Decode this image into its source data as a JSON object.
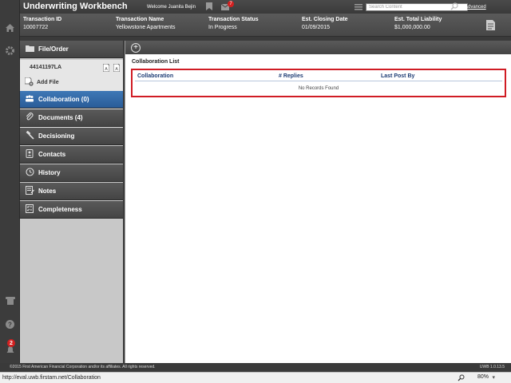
{
  "header": {
    "app_title": "Underwriting Workbench",
    "welcome": "Welcome Juanita Bejin",
    "messages_badge": "7",
    "search_placeholder": "Search Content",
    "advanced_link": "Advanced"
  },
  "transaction": {
    "columns": [
      {
        "label": "Transaction ID",
        "value": "10007722"
      },
      {
        "label": "Transaction Name",
        "value": "Yellowstone Apartments"
      },
      {
        "label": "Transaction Status",
        "value": "In Progress"
      },
      {
        "label": "Est. Closing Date",
        "value": "01/09/2015"
      },
      {
        "label": "Est. Total Liability",
        "value": "$1,000,000.00"
      }
    ]
  },
  "sidebar": {
    "file_order": "File/Order",
    "file_number": "44141197LA",
    "add_file": "Add File",
    "items": [
      {
        "label": "Collaboration (0)",
        "icon": "collaboration-icon",
        "active": true
      },
      {
        "label": "Documents (4)",
        "icon": "paperclip-icon",
        "active": false
      },
      {
        "label": "Decisioning",
        "icon": "gavel-icon",
        "active": false
      },
      {
        "label": "Contacts",
        "icon": "contacts-icon",
        "active": false
      },
      {
        "label": "History",
        "icon": "clock-icon",
        "active": false
      },
      {
        "label": "Notes",
        "icon": "notes-icon",
        "active": false
      },
      {
        "label": "Completeness",
        "icon": "checklist-icon",
        "active": false
      }
    ]
  },
  "rail": {
    "notification_badge": "2"
  },
  "main": {
    "list_title": "Collaboration List",
    "columns": [
      "Collaboration",
      "# Replies",
      "Last Post By"
    ],
    "empty_message": "No Records Found"
  },
  "footer": {
    "copyright": "©2015 First American Financial Corporation and/or its affiliates. All rights reserved.",
    "version": "UWB 1.0.13.5"
  },
  "statusbar": {
    "url": "http://eval.uwb.firstam.net/Collaboration",
    "zoom": "80%"
  },
  "colors": {
    "active_nav": "#2f66a8",
    "highlight_border": "#d01c24",
    "badge": "#d42020"
  }
}
